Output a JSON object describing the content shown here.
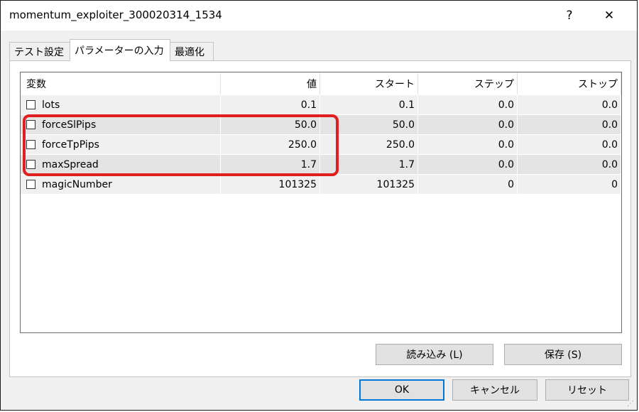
{
  "window": {
    "title": "momentum_exploiter_300020314_1534",
    "help_label": "?",
    "close_label": "✕"
  },
  "tabs": [
    {
      "label": "テスト設定"
    },
    {
      "label": "パラメーターの入力"
    },
    {
      "label": "最適化"
    }
  ],
  "table": {
    "headers": [
      "変数",
      "値",
      "スタート",
      "ステップ",
      "ストップ"
    ],
    "rows": [
      {
        "name": "lots",
        "value": "0.1",
        "start": "0.1",
        "step": "0.0",
        "stop": "0.0"
      },
      {
        "name": "forceSlPips",
        "value": "50.0",
        "start": "50.0",
        "step": "0.0",
        "stop": "0.0"
      },
      {
        "name": "forceTpPips",
        "value": "250.0",
        "start": "250.0",
        "step": "0.0",
        "stop": "0.0"
      },
      {
        "name": "maxSpread",
        "value": "1.7",
        "start": "1.7",
        "step": "0.0",
        "stop": "0.0"
      },
      {
        "name": "magicNumber",
        "value": "101325",
        "start": "101325",
        "step": "0",
        "stop": "0"
      }
    ]
  },
  "buttons": {
    "load": "読み込み (L)",
    "save": "保存 (S)",
    "ok": "OK",
    "cancel": "キャンセル",
    "reset": "リセット"
  },
  "colors": {
    "highlight": "#e02020",
    "default_button_border": "#0078d7"
  }
}
